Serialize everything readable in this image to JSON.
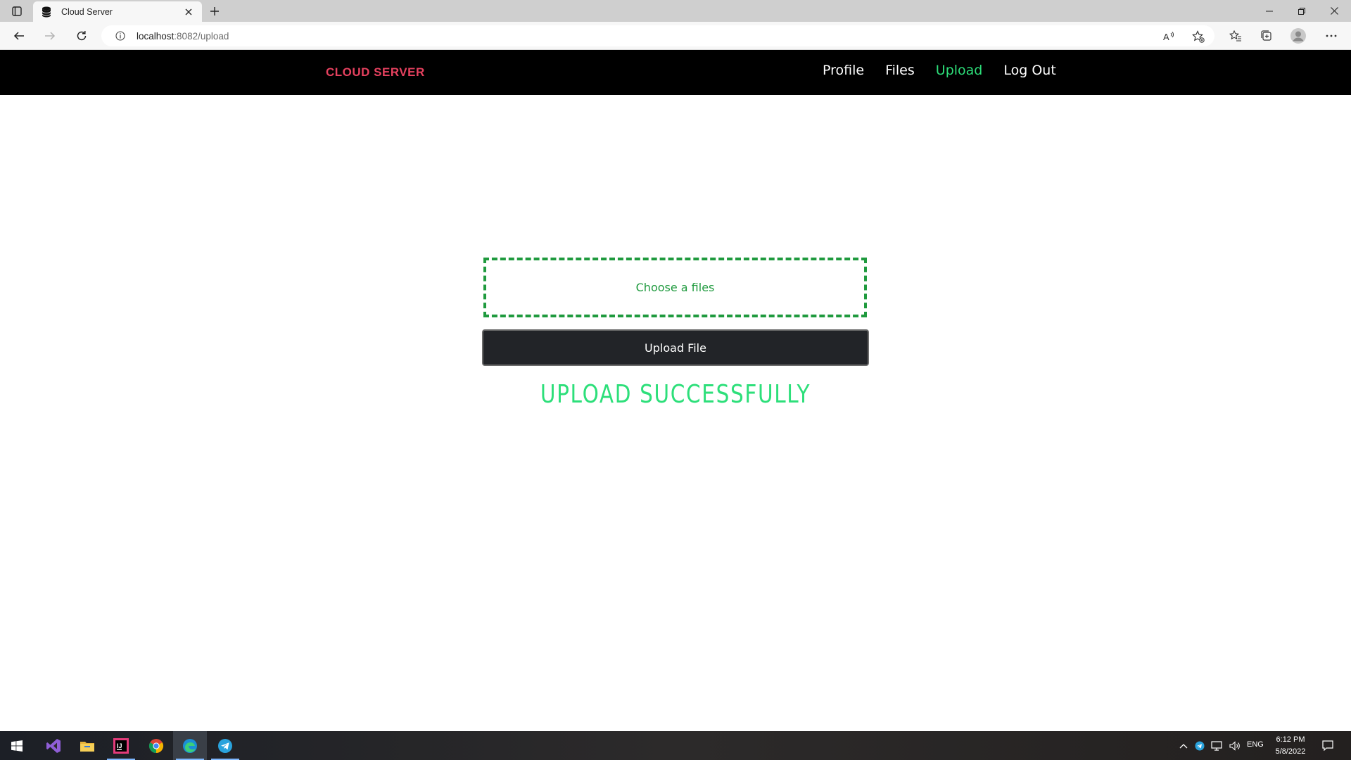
{
  "browser": {
    "tab_title": "Cloud Server",
    "url_host": "localhost",
    "url_rest": ":8082/upload"
  },
  "site": {
    "brand": "CLOUD SERVER",
    "nav": {
      "profile": "Profile",
      "files": "Files",
      "upload": "Upload",
      "logout": "Log Out"
    },
    "colors": {
      "brand": "#e6415f",
      "active_link": "#2ddf7a",
      "success": "#2ddf7a",
      "dropzone": "#1f9a3e",
      "button_bg": "#222428"
    }
  },
  "main": {
    "dropzone_label": "Choose a files",
    "upload_button": "Upload File",
    "status": "UPLOAD SUCCESSFULLY"
  },
  "taskbar": {
    "lang": "ENG",
    "time": "6:12 PM",
    "date": "5/8/2022",
    "apps": [
      "windows-start-icon",
      "visual-studio-icon",
      "file-explorer-icon",
      "intellij-icon",
      "chrome-icon",
      "edge-icon",
      "telegram-icon"
    ]
  }
}
